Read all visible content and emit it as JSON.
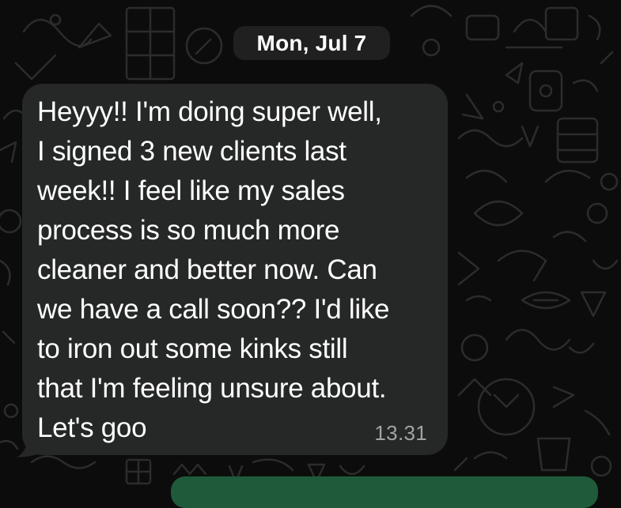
{
  "chat": {
    "date_separator": "Mon, Jul 7",
    "messages": [
      {
        "text": "Heyyy!! I'm doing super well,\nI signed 3 new clients last\nweek!! I feel like my sales\nprocess is so much more\ncleaner and better now. Can\nwe have a call soon?? I'd like\nto iron out some kinks still\nthat I'm feeling unsure about.\nLet's goo",
        "time": "13.31",
        "direction": "incoming"
      }
    ]
  },
  "colors": {
    "background": "#0c0c0c",
    "bubble_incoming": "#262727",
    "date_chip": "#202020",
    "timestamp": "#a3a3a3",
    "outgoing_bubble_peek": "#1f5a3a"
  },
  "icons": {
    "wallpaper": "doodle-pattern-icon"
  }
}
